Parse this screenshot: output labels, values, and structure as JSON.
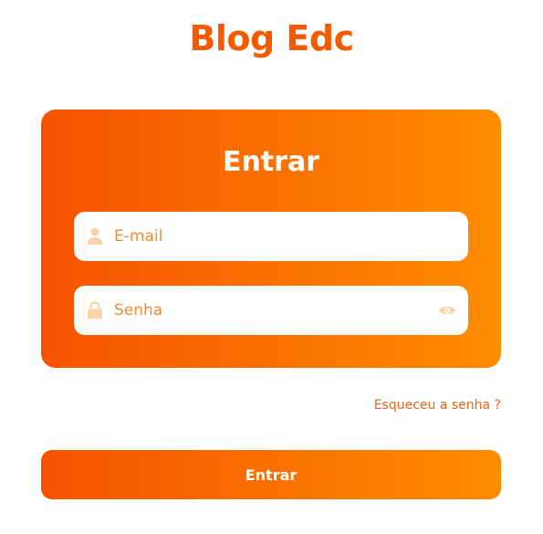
{
  "brand": {
    "title": "Blog Edc"
  },
  "login_card": {
    "title": "Entrar",
    "email": {
      "placeholder": "E-mail",
      "value": "",
      "icon": "user-icon"
    },
    "password": {
      "placeholder": "Senha",
      "value": "",
      "icon": "lock-icon",
      "toggle_icon": "eye-icon"
    }
  },
  "forgot_password": {
    "label": "Esqueceu a senha ?"
  },
  "submit": {
    "label": "Entrar"
  },
  "colors": {
    "accent": "#f45b00",
    "gradient_start": "#f55200",
    "gradient_end": "#ff8c00",
    "icon_tint": "#fcd3a8"
  }
}
